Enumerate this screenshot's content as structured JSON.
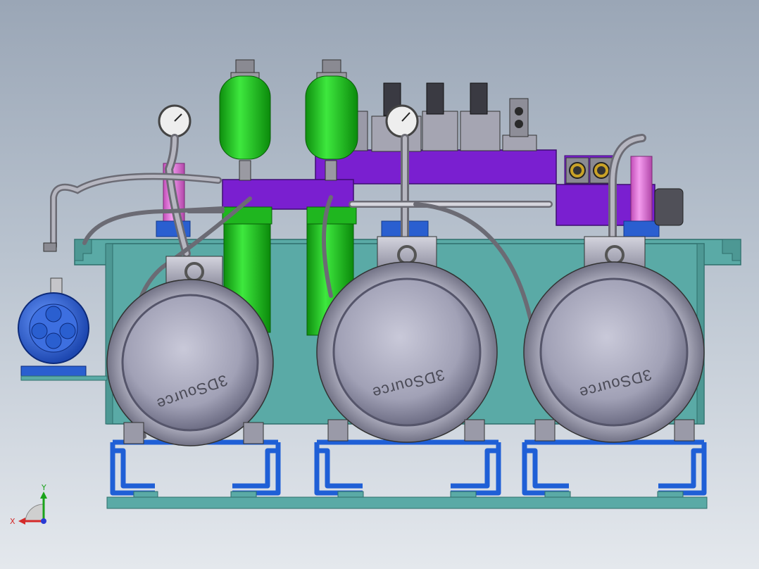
{
  "viewport": {
    "background_top": "#9aa6b6",
    "background_bottom": "#e4e8ed"
  },
  "colors": {
    "tank": "#5aaaa6",
    "tank_edge": "#3a7f7c",
    "accumulator": "#1fc41f",
    "manifold": "#7a1fd0",
    "motor": "#a8a8bd",
    "pump": "#2a5fd0",
    "skid": "#1f5fd6",
    "pipe": "#8c8c94",
    "lilac": "#e070d8"
  },
  "motors": [
    {
      "label": "3DSource"
    },
    {
      "label": "3DSource"
    },
    {
      "label": "3DSource"
    }
  ],
  "triad": {
    "x_label": "X",
    "y_label": "Y"
  },
  "icons": [
    "pressure-gauge-icon",
    "eye-bolt-icon",
    "solenoid-valve-icon",
    "coordinate-triad-icon"
  ]
}
